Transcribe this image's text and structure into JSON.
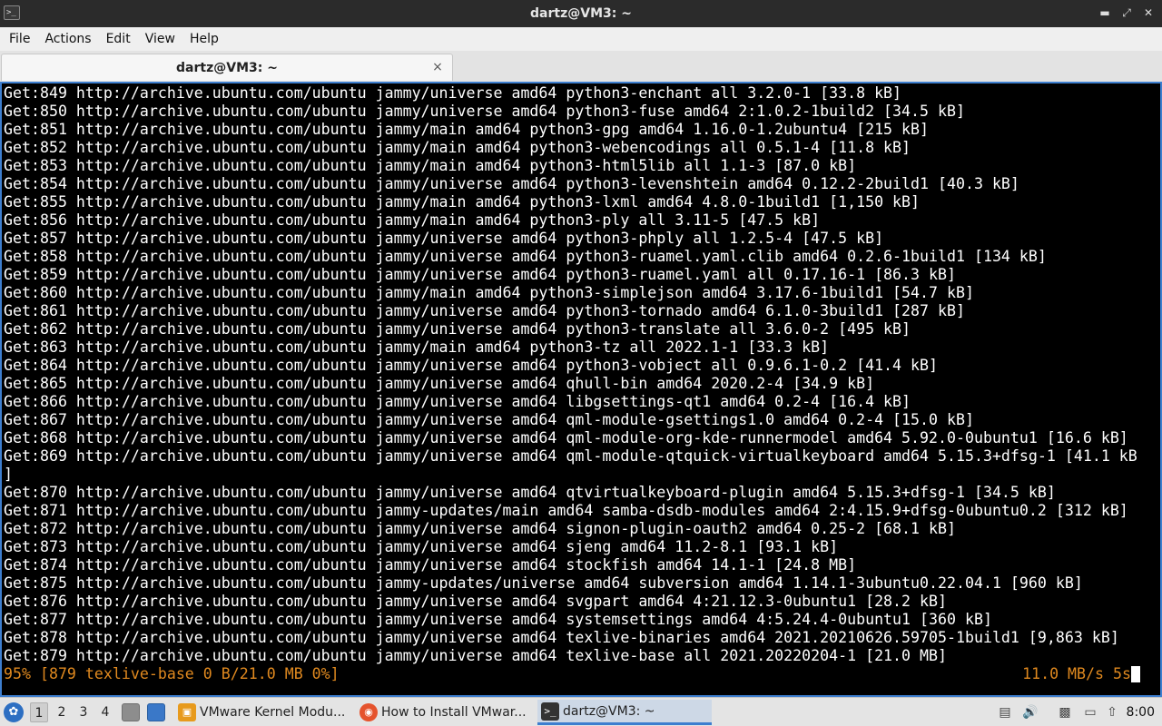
{
  "window": {
    "title": "dartz@VM3: ~",
    "icon": "terminal-icon",
    "controls": [
      "minimize-icon",
      "maximize-icon",
      "close-icon"
    ]
  },
  "menu": [
    "File",
    "Actions",
    "Edit",
    "View",
    "Help"
  ],
  "tab": {
    "label": "dartz@VM3: ~",
    "close": "×"
  },
  "terminal": {
    "lines": [
      "Get:849 http://archive.ubuntu.com/ubuntu jammy/universe amd64 python3-enchant all 3.2.0-1 [33.8 kB]",
      "Get:850 http://archive.ubuntu.com/ubuntu jammy/universe amd64 python3-fuse amd64 2:1.0.2-1build2 [34.5 kB]",
      "Get:851 http://archive.ubuntu.com/ubuntu jammy/main amd64 python3-gpg amd64 1.16.0-1.2ubuntu4 [215 kB]",
      "Get:852 http://archive.ubuntu.com/ubuntu jammy/main amd64 python3-webencodings all 0.5.1-4 [11.8 kB]",
      "Get:853 http://archive.ubuntu.com/ubuntu jammy/main amd64 python3-html5lib all 1.1-3 [87.0 kB]",
      "Get:854 http://archive.ubuntu.com/ubuntu jammy/universe amd64 python3-levenshtein amd64 0.12.2-2build1 [40.3 kB]",
      "Get:855 http://archive.ubuntu.com/ubuntu jammy/main amd64 python3-lxml amd64 4.8.0-1build1 [1,150 kB]",
      "Get:856 http://archive.ubuntu.com/ubuntu jammy/main amd64 python3-ply all 3.11-5 [47.5 kB]",
      "Get:857 http://archive.ubuntu.com/ubuntu jammy/universe amd64 python3-phply all 1.2.5-4 [47.5 kB]",
      "Get:858 http://archive.ubuntu.com/ubuntu jammy/universe amd64 python3-ruamel.yaml.clib amd64 0.2.6-1build1 [134 kB]",
      "Get:859 http://archive.ubuntu.com/ubuntu jammy/universe amd64 python3-ruamel.yaml all 0.17.16-1 [86.3 kB]",
      "Get:860 http://archive.ubuntu.com/ubuntu jammy/main amd64 python3-simplejson amd64 3.17.6-1build1 [54.7 kB]",
      "Get:861 http://archive.ubuntu.com/ubuntu jammy/universe amd64 python3-tornado amd64 6.1.0-3build1 [287 kB]",
      "Get:862 http://archive.ubuntu.com/ubuntu jammy/universe amd64 python3-translate all 3.6.0-2 [495 kB]",
      "Get:863 http://archive.ubuntu.com/ubuntu jammy/main amd64 python3-tz all 2022.1-1 [33.3 kB]",
      "Get:864 http://archive.ubuntu.com/ubuntu jammy/universe amd64 python3-vobject all 0.9.6.1-0.2 [41.4 kB]",
      "Get:865 http://archive.ubuntu.com/ubuntu jammy/universe amd64 qhull-bin amd64 2020.2-4 [34.9 kB]",
      "Get:866 http://archive.ubuntu.com/ubuntu jammy/universe amd64 libgsettings-qt1 amd64 0.2-4 [16.4 kB]",
      "Get:867 http://archive.ubuntu.com/ubuntu jammy/universe amd64 qml-module-gsettings1.0 amd64 0.2-4 [15.0 kB]",
      "Get:868 http://archive.ubuntu.com/ubuntu jammy/universe amd64 qml-module-org-kde-runnermodel amd64 5.92.0-0ubuntu1 [16.6 kB]",
      "Get:869 http://archive.ubuntu.com/ubuntu jammy/universe amd64 qml-module-qtquick-virtualkeyboard amd64 5.15.3+dfsg-1 [41.1 kB",
      "]",
      "Get:870 http://archive.ubuntu.com/ubuntu jammy/universe amd64 qtvirtualkeyboard-plugin amd64 5.15.3+dfsg-1 [34.5 kB]",
      "Get:871 http://archive.ubuntu.com/ubuntu jammy-updates/main amd64 samba-dsdb-modules amd64 2:4.15.9+dfsg-0ubuntu0.2 [312 kB]",
      "Get:872 http://archive.ubuntu.com/ubuntu jammy/universe amd64 signon-plugin-oauth2 amd64 0.25-2 [68.1 kB]",
      "Get:873 http://archive.ubuntu.com/ubuntu jammy/universe amd64 sjeng amd64 11.2-8.1 [93.1 kB]",
      "Get:874 http://archive.ubuntu.com/ubuntu jammy/universe amd64 stockfish amd64 14.1-1 [24.8 MB]",
      "Get:875 http://archive.ubuntu.com/ubuntu jammy-updates/universe amd64 subversion amd64 1.14.1-3ubuntu0.22.04.1 [960 kB]",
      "Get:876 http://archive.ubuntu.com/ubuntu jammy/universe amd64 svgpart amd64 4:21.12.3-0ubuntu1 [28.2 kB]",
      "Get:877 http://archive.ubuntu.com/ubuntu jammy/universe amd64 systemsettings amd64 4:5.24.4-0ubuntu1 [360 kB]",
      "Get:878 http://archive.ubuntu.com/ubuntu jammy/universe amd64 texlive-binaries amd64 2021.20210626.59705-1build1 [9,863 kB]",
      "Get:879 http://archive.ubuntu.com/ubuntu jammy/universe amd64 texlive-base all 2021.20220204-1 [21.0 MB]"
    ],
    "progress_text": "95% [879 texlive-base 0 B/21.0 MB 0%]",
    "speed_text": "11.0 MB/s 5s",
    "colors": {
      "background": "#000000",
      "text": "#ffffff",
      "progress": "#e0891f",
      "border": "#3d7ecf"
    }
  },
  "taskbar": {
    "workspaces": [
      "1",
      "2",
      "3",
      "4"
    ],
    "active_workspace": "1",
    "launchers": [
      "file-manager-icon",
      "desktop-icon"
    ],
    "tasks": [
      {
        "label": "VMware Kernel Modu...",
        "icon": "vmware-icon"
      },
      {
        "label": "How to Install VMwar...",
        "icon": "firefox-icon"
      },
      {
        "label": "dartz@VM3: ~",
        "icon": "terminal-icon"
      }
    ],
    "tray": [
      "clipboard-icon",
      "volume-icon",
      "notes-icon",
      "display-icon",
      "update-icon"
    ],
    "clock": "8:00"
  }
}
